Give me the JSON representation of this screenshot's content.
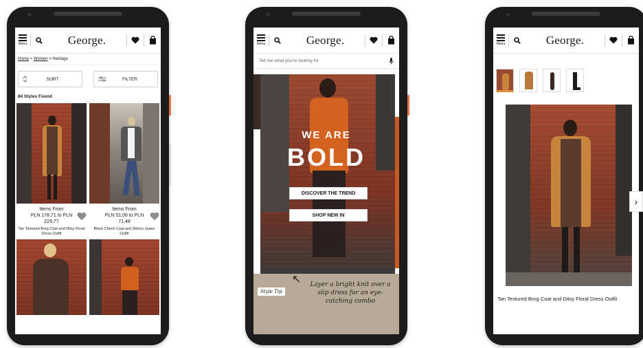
{
  "header": {
    "menu_label": "Menu",
    "logo": "George."
  },
  "screen1": {
    "breadcrumb": {
      "home": "Home",
      "sep1": " > ",
      "women": "Women",
      "sep2": " > ",
      "current": "Heritage"
    },
    "sort_label": "SORT",
    "filter_label": "FILTER",
    "styles_found": "84 Styles Found",
    "products": [
      {
        "from": "Items From",
        "price": "PLN 178,71 to PLN 229,77",
        "name": "Tan Textured Borg Coat and Ditsy Floral Dress Outfit"
      },
      {
        "from": "Items From",
        "price": "PLN 51,06 to PLN 71,48",
        "name": "Black Check Coat and Skinny Jeans Outfit"
      }
    ]
  },
  "screen2": {
    "search_placeholder": "Tell me what you're looking for",
    "hero_line1": "WE ARE",
    "hero_line2": "BOLD",
    "cta1": "DISCOVER THE TREND",
    "cta2": "SHOP NEW IN",
    "style_tip_label": "Style Tip",
    "style_tip_text": "Layer a bright knit over a slip dress for an eye-catching combo"
  },
  "screen3": {
    "product_title": "Tan Textured Borg Coat and Ditsy Floral Dress Outfit"
  },
  "colors": {
    "accent_orange": "#e08a3c",
    "brick": "#a3472f",
    "tip_bg": "#b7ab98"
  }
}
